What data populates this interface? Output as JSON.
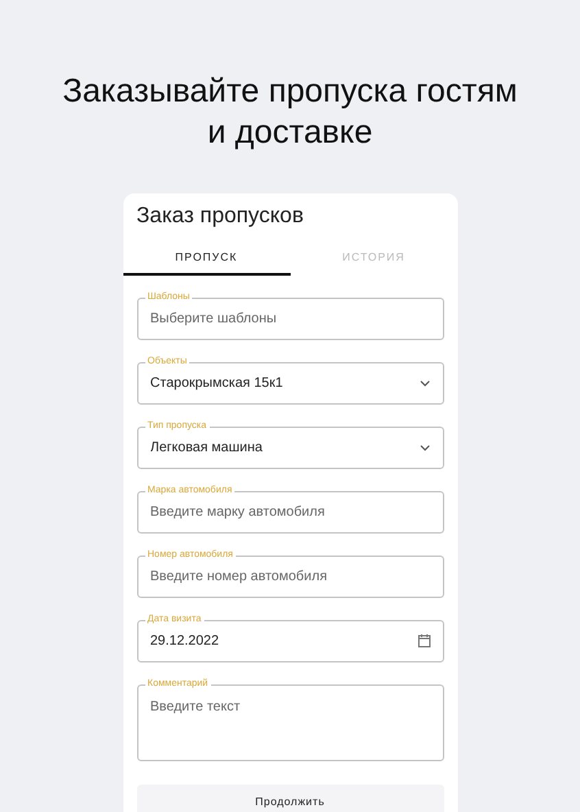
{
  "headline": "Заказывайте пропуска гостям и доставке",
  "card": {
    "title": "Заказ пропусков",
    "tabs": [
      {
        "label": "ПРОПУСК",
        "selected": true
      },
      {
        "label": "ИСТОРИЯ",
        "selected": false
      }
    ],
    "fields": [
      {
        "kind": "text",
        "label": "Шаблоны",
        "placeholder": "Выберите шаблоны"
      },
      {
        "kind": "select",
        "label": "Объекты",
        "value": "Старокрымская 15к1"
      },
      {
        "kind": "select",
        "label": "Тип пропуска",
        "value": "Легковая машина"
      },
      {
        "kind": "text",
        "label": "Марка автомобиля",
        "placeholder": "Введите марку автомобиля"
      },
      {
        "kind": "text",
        "label": "Номер автомобиля",
        "placeholder": "Введите номер автомобиля"
      },
      {
        "kind": "date",
        "label": "Дата визита",
        "value": "29.12.2022"
      },
      {
        "kind": "textarea",
        "label": "Комментарий",
        "placeholder": "Введите текст"
      }
    ],
    "button": "Продолжить"
  }
}
